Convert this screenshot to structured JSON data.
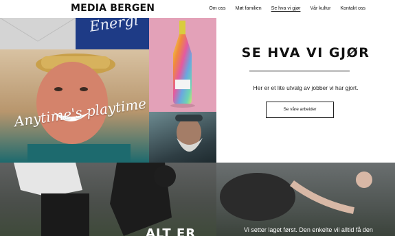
{
  "header": {
    "logo": "MEDIA BERGEN",
    "nav": [
      {
        "label": "Om oss",
        "active": false
      },
      {
        "label": "Møt familien",
        "active": false
      },
      {
        "label": "Se hva vi gjør",
        "active": true
      },
      {
        "label": "Vår kultur",
        "active": false
      },
      {
        "label": "Kontakt oss",
        "active": false
      }
    ]
  },
  "collage": {
    "blue_tile_script": "Energi",
    "man_tile_script": "Anytime's playtime"
  },
  "hero": {
    "title": "SE HVA VI GJØR",
    "subtitle": "Her er et lite utvalg av jobber vi har gjort.",
    "button_label": "Se våre arbeider"
  },
  "bottom": {
    "headline": "ALT ER",
    "text": "Vi setter laget først. Den enkelte vil alltid få den"
  },
  "colors": {
    "accent_blue": "#1e3b86",
    "pink_tile": "#e3a1b8",
    "text": "#111111",
    "background": "#ffffff"
  }
}
